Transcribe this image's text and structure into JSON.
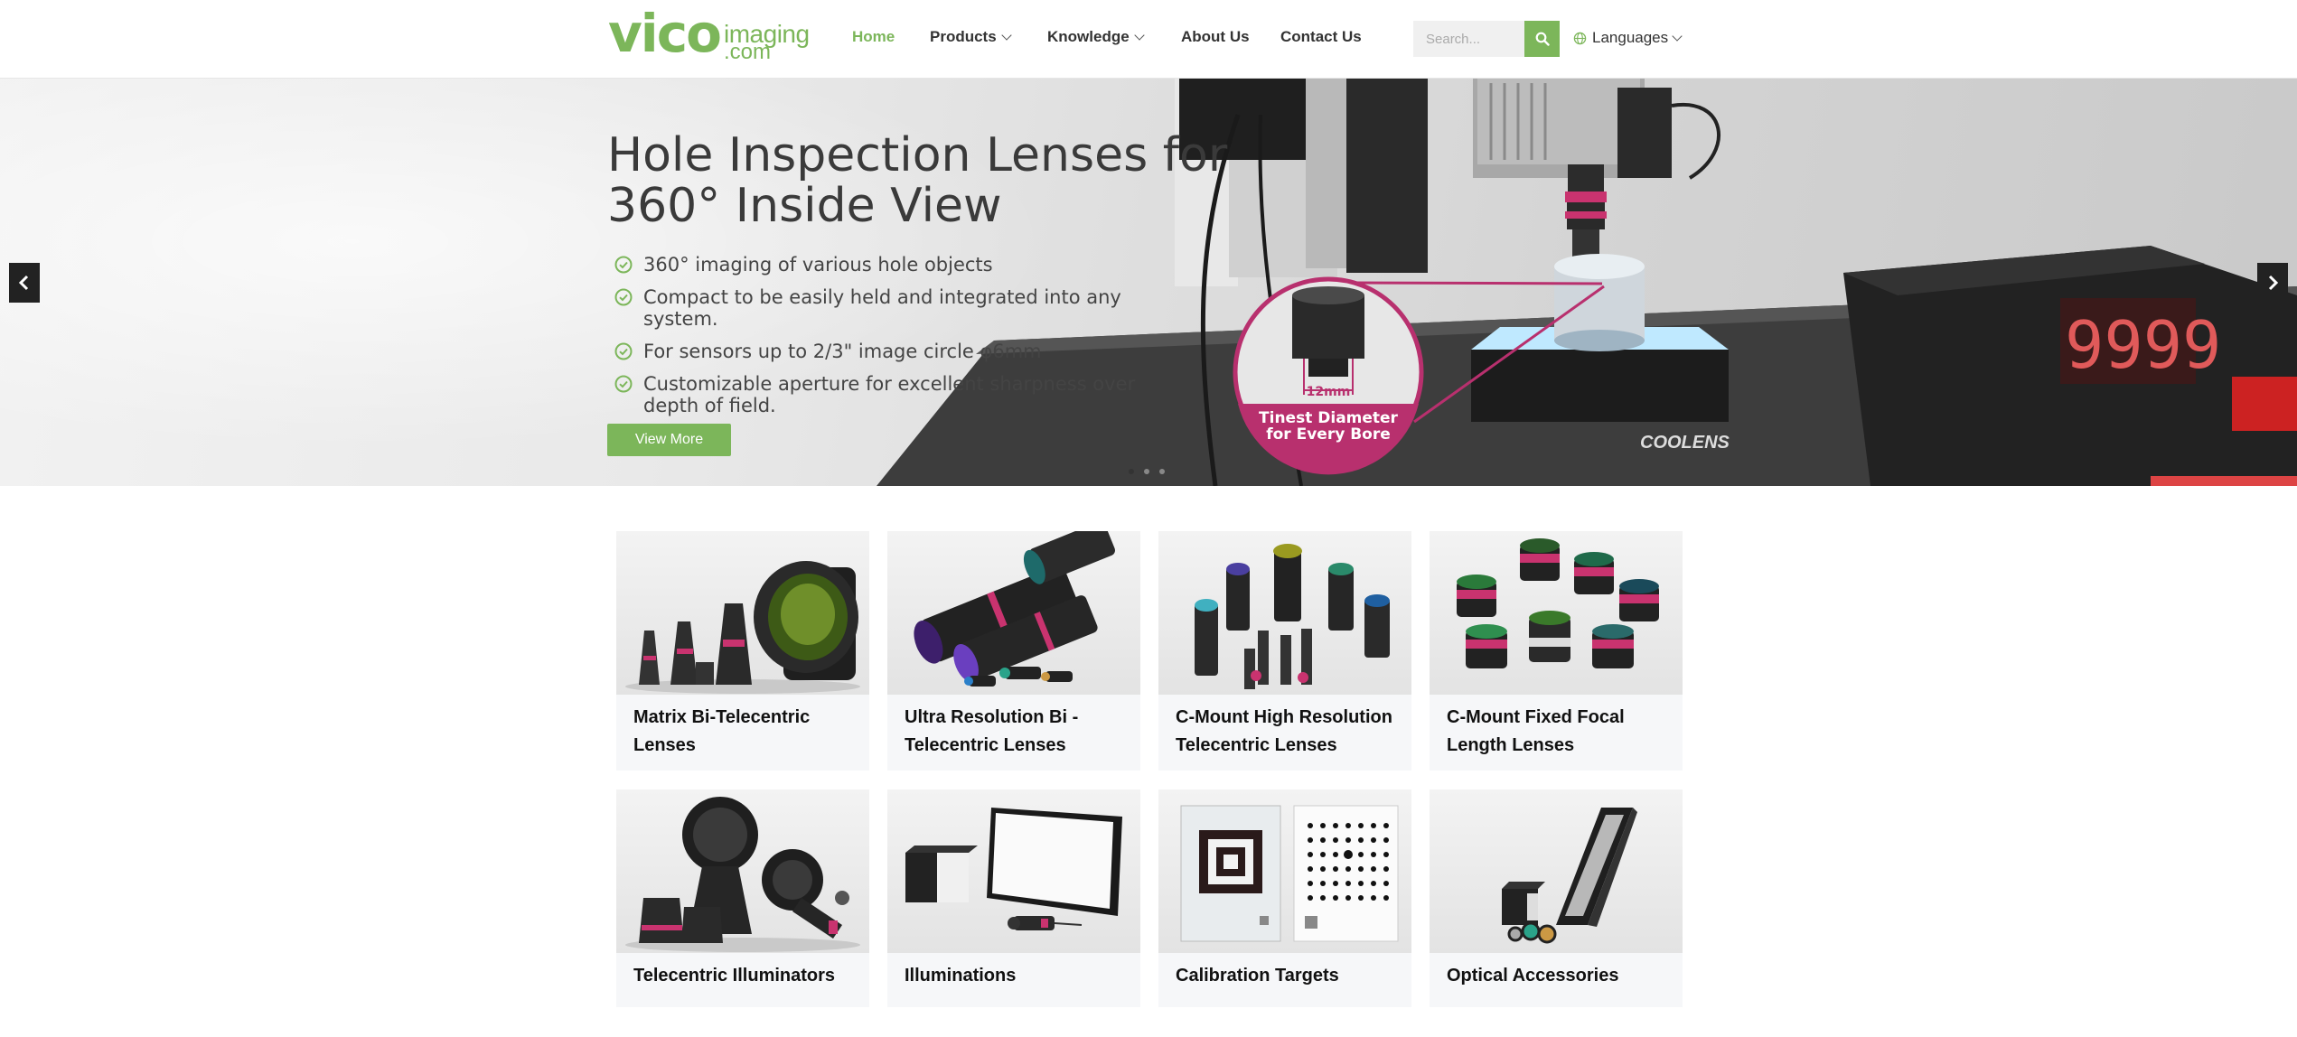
{
  "logo": {
    "main": "vico",
    "sub_top": "imaging",
    "sub_bottom": ".com"
  },
  "nav": {
    "items": [
      {
        "label": "Home",
        "active": true,
        "dropdown": false
      },
      {
        "label": "Products",
        "active": false,
        "dropdown": true
      },
      {
        "label": "Knowledge",
        "active": false,
        "dropdown": true
      },
      {
        "label": "About Us",
        "active": false,
        "dropdown": false
      },
      {
        "label": "Contact Us",
        "active": false,
        "dropdown": false
      }
    ],
    "search_placeholder": "Search...",
    "languages_label": "Languages"
  },
  "hero": {
    "title": "Hole Inspection Lenses for 360° Inside View",
    "bullets": [
      "360° imaging of various hole objects",
      "Compact to be easily held and integrated into any system.",
      "For sensors up to 2/3\" image circle φ6mm",
      "Customizable aperture for excellent sharpness over depth of field."
    ],
    "button_label": "View More",
    "callout_dimension": "12mm",
    "callout_line1": "Tinest Diameter",
    "callout_line2": "for Every Bore",
    "display_readout": "9999",
    "box_brand": "COOLENS",
    "slide_count": 3,
    "active_slide": 1
  },
  "products": [
    {
      "label": "Matrix Bi-Telecentric Lenses"
    },
    {
      "label": "Ultra Resolution Bi -Telecentric Lenses"
    },
    {
      "label": "C-Mount High Resolution Telecentric Lenses"
    },
    {
      "label": "C-Mount Fixed Focal Length Lenses"
    },
    {
      "label": "Telecentric Illuminators"
    },
    {
      "label": "Illuminations"
    },
    {
      "label": "Calibration Targets"
    },
    {
      "label": "Optical Accessories"
    }
  ],
  "colors": {
    "brand": "#7cb65a",
    "accent_magenta": "#b8306e",
    "dark": "#222222"
  },
  "icons": [
    "search-icon",
    "globe-icon",
    "check-circle-icon",
    "chevron-left-icon",
    "chevron-right-icon",
    "chevron-down-icon"
  ]
}
